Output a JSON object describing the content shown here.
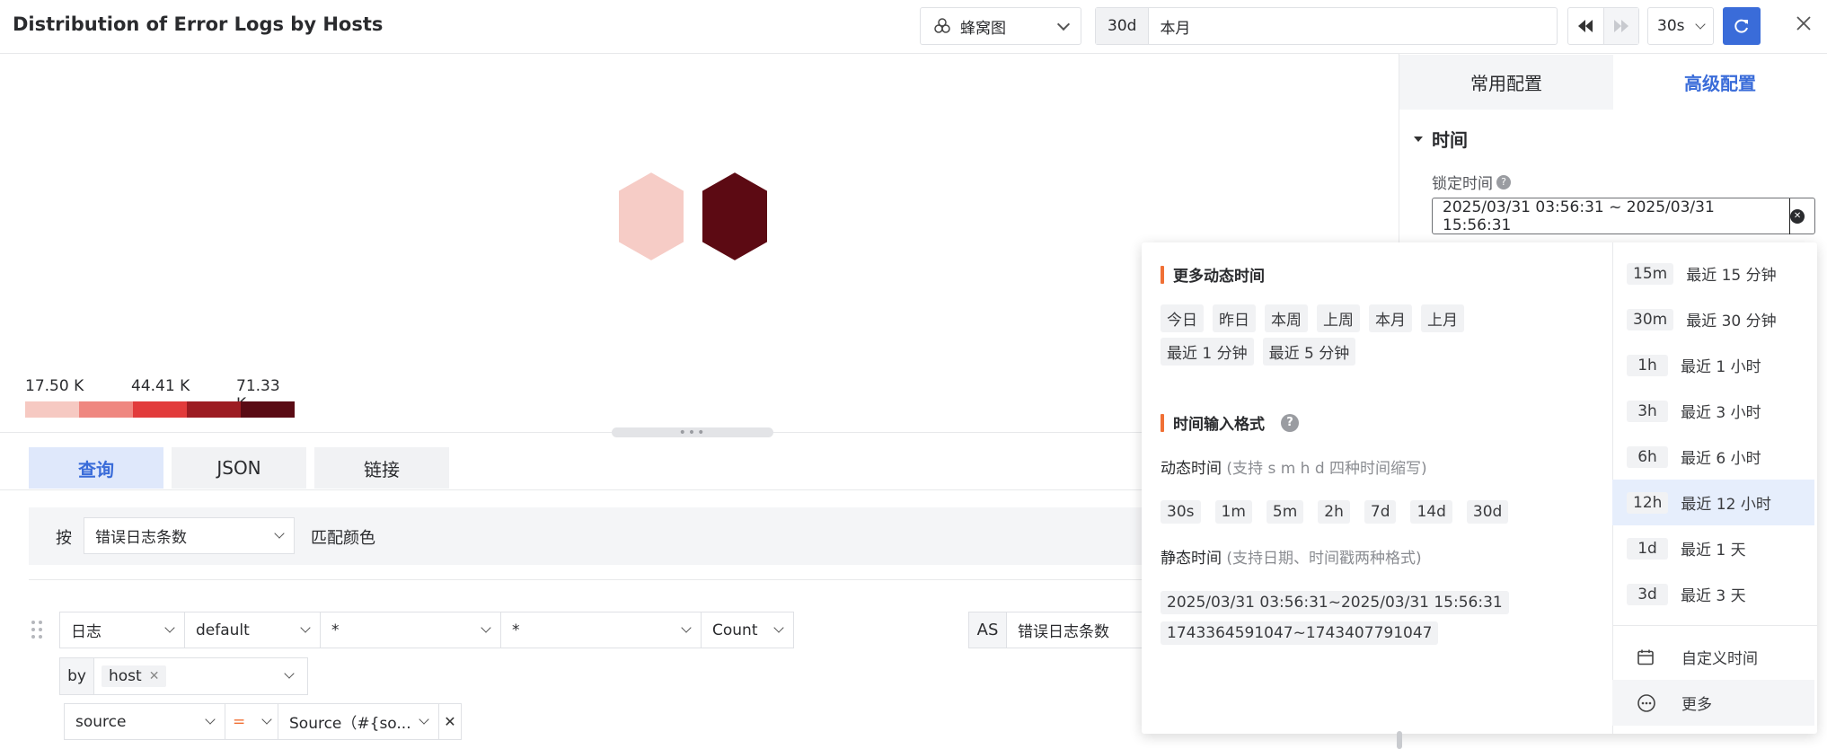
{
  "header": {
    "title": "Distribution of Error Logs by Hosts",
    "chart_type_label": "蜂窝图",
    "time_badge": "30d",
    "time_value": "本月",
    "refresh_interval": "30s"
  },
  "legend": {
    "ticks": [
      "17.50 K",
      "44.41 K",
      "71.33 K"
    ],
    "colors": [
      "#f6c9c2",
      "#ef8780",
      "#e23b3b",
      "#9c1c22",
      "#5a0b14"
    ]
  },
  "honeycomb": {
    "colors": [
      "#f6ccc6",
      "#5c0a13"
    ]
  },
  "query_tabs": [
    "查询",
    "JSON",
    "链接"
  ],
  "color_rule": {
    "by_label": "按",
    "metric": "错误日志条数",
    "suffix": "匹配颜色"
  },
  "query": {
    "source_type": "日志",
    "index": "default",
    "field1": "*",
    "field2": "*",
    "agg": "Count",
    "as_label": "AS",
    "alias": "错误日志条数",
    "by_label": "by",
    "by_tag": "host",
    "filter_field": "source",
    "filter_op": "=",
    "filter_value": "Source（#{so..."
  },
  "side_panel": {
    "tabs": [
      "常用配置",
      "高级配置"
    ],
    "section_title": "时间",
    "lock_label": "锁定时间",
    "lock_value": "2025/03/31 03:56:31 ~ 2025/03/31 15:56:31"
  },
  "popover": {
    "dynamic_title": "更多动态时间",
    "dynamic_chips": [
      "今日",
      "昨日",
      "本周",
      "上周",
      "本月",
      "上月",
      "最近 1 分钟",
      "最近 5 分钟"
    ],
    "format_title": "时间输入格式",
    "dynamic_time_label": "动态时间",
    "dynamic_time_hint": "(支持 s m h d 四种时间缩写)",
    "dynamic_examples": [
      "30s",
      "1m",
      "5m",
      "2h",
      "7d",
      "14d",
      "30d"
    ],
    "static_time_label": "静态时间",
    "static_time_hint": "(支持日期、时间戳两种格式)",
    "static_examples": [
      "2025/03/31 03:56:31~2025/03/31 15:56:31",
      "1743364591047~1743407791047"
    ],
    "quick": [
      {
        "tag": "15m",
        "label": "最近 15 分钟"
      },
      {
        "tag": "30m",
        "label": "最近 30 分钟"
      },
      {
        "tag": "1h",
        "label": "最近 1 小时"
      },
      {
        "tag": "3h",
        "label": "最近 3 小时"
      },
      {
        "tag": "6h",
        "label": "最近 6 小时"
      },
      {
        "tag": "12h",
        "label": "最近 12 小时"
      },
      {
        "tag": "1d",
        "label": "最近 1 天"
      },
      {
        "tag": "3d",
        "label": "最近 3 天"
      }
    ],
    "custom_label": "自定义时间",
    "more_label": "更多"
  },
  "accent": "#3a6cd9"
}
